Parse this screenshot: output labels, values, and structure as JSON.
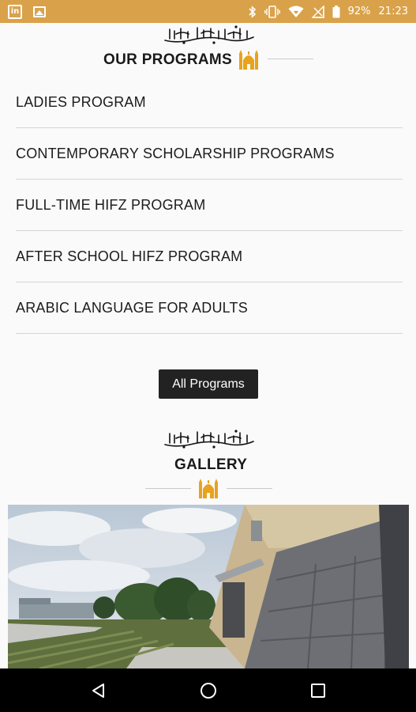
{
  "status_bar": {
    "battery_percent": "92%",
    "time": "21:23",
    "left_icons": [
      "linkedin-icon",
      "image-icon"
    ],
    "right_icons": [
      "bluetooth-icon",
      "vibrate-icon",
      "wifi-icon",
      "signal-icon",
      "battery-icon"
    ],
    "linkedin_glyph": "in",
    "background_color": "#d9a24a"
  },
  "programs": {
    "title": "OUR PROGRAMS",
    "items": [
      "LADIES PROGRAM",
      "CONTEMPORARY SCHOLARSHIP PROGRAMS",
      "FULL-TIME HIFZ PROGRAM",
      "AFTER SCHOOL HIFZ PROGRAM",
      "ARABIC LANGUAGE FOR ADULTS"
    ],
    "all_programs_label": "All Programs"
  },
  "gallery": {
    "title": "GALLERY"
  },
  "colors": {
    "accent": "#e8a21d",
    "text": "#1c1c1c",
    "button": "#222222",
    "divider": "#d5d5d5"
  },
  "nav_bar": {
    "icons": [
      "back-icon",
      "home-icon",
      "recents-icon"
    ]
  }
}
